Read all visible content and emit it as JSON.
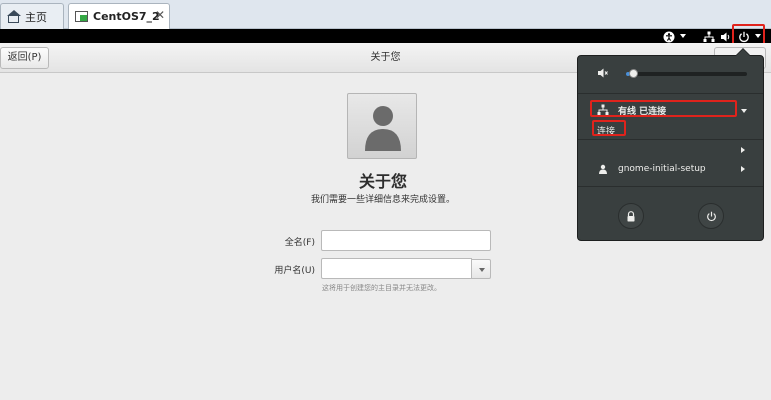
{
  "host_tabs": [
    {
      "label": "主页",
      "icon": "home-icon"
    },
    {
      "label": "CentOS7_2",
      "icon": "vm-icon",
      "close": "✕"
    }
  ],
  "gnome_bar": {
    "accessibility_icon": "accessibility-icon",
    "network_icon": "network-wired-icon",
    "volume_icon": "volume-icon",
    "power_icon": "power-icon"
  },
  "header": {
    "back_label": "返回(P)",
    "title": "关于您"
  },
  "main": {
    "title": "关于您",
    "subtitle": "我们需要一些详细信息来完成设置。",
    "fullname_label": "全名(F)",
    "fullname_value": "",
    "username_label": "用户名(U)",
    "username_value": "",
    "username_hint": "这将用于创建您的主目录并无法更改。"
  },
  "system_menu": {
    "volume_level": 0.03,
    "network_label": "有线 已连接",
    "network_connect": "连接",
    "user_name": "gnome-initial-setup",
    "lock_icon": "lock-icon",
    "power_icon": "power-icon"
  },
  "highlight_color": "#e0231c"
}
